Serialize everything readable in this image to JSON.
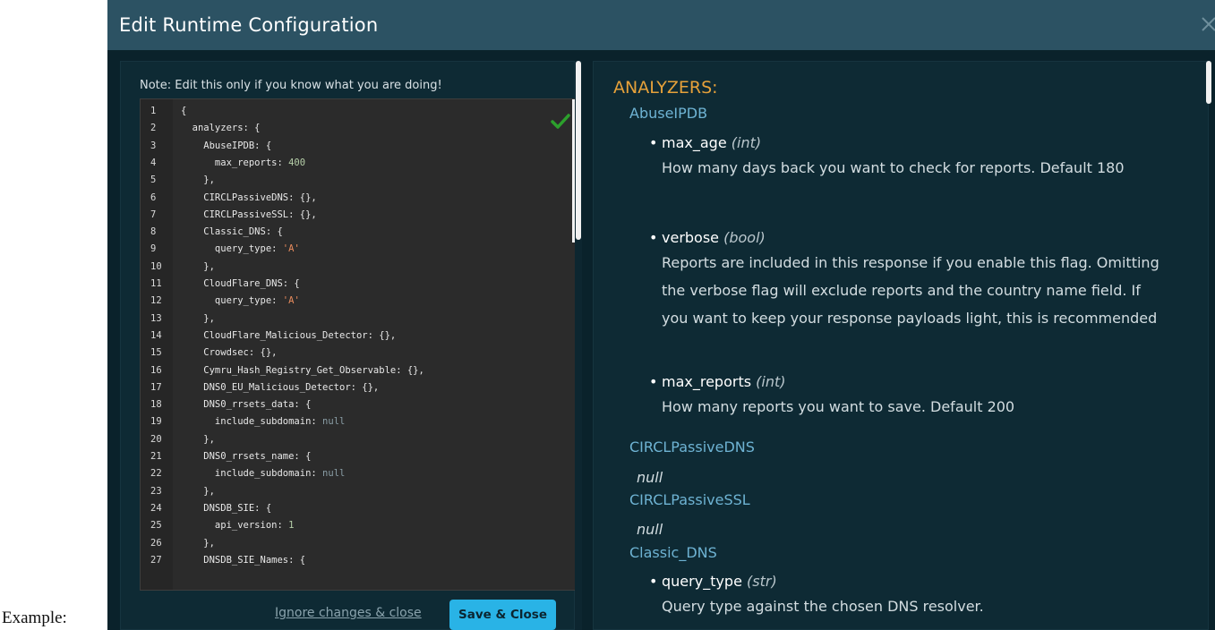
{
  "caption": "Example:",
  "modal": {
    "title": "Edit Runtime Configuration",
    "close_icon": "close-icon"
  },
  "editor": {
    "note": "Note: Edit this only if you know what you are doing!",
    "valid_icon": "check-icon",
    "lines": [
      {
        "n": "1",
        "key": "{",
        "val": "",
        "type": ""
      },
      {
        "n": "2",
        "key": "  analyzers: {",
        "val": "",
        "type": ""
      },
      {
        "n": "3",
        "key": "    AbuseIPDB: {",
        "val": "",
        "type": ""
      },
      {
        "n": "4",
        "key": "      max_reports: ",
        "val": "400",
        "type": "num"
      },
      {
        "n": "5",
        "key": "    },",
        "val": "",
        "type": ""
      },
      {
        "n": "6",
        "key": "    CIRCLPassiveDNS: {},",
        "val": "",
        "type": ""
      },
      {
        "n": "7",
        "key": "    CIRCLPassiveSSL: {},",
        "val": "",
        "type": ""
      },
      {
        "n": "8",
        "key": "    Classic_DNS: {",
        "val": "",
        "type": ""
      },
      {
        "n": "9",
        "key": "      query_type: ",
        "val": "'A'",
        "type": "str"
      },
      {
        "n": "10",
        "key": "    },",
        "val": "",
        "type": ""
      },
      {
        "n": "11",
        "key": "    CloudFlare_DNS: {",
        "val": "",
        "type": ""
      },
      {
        "n": "12",
        "key": "      query_type: ",
        "val": "'A'",
        "type": "str"
      },
      {
        "n": "13",
        "key": "    },",
        "val": "",
        "type": ""
      },
      {
        "n": "14",
        "key": "    CloudFlare_Malicious_Detector: {},",
        "val": "",
        "type": ""
      },
      {
        "n": "15",
        "key": "    Crowdsec: {},",
        "val": "",
        "type": ""
      },
      {
        "n": "16",
        "key": "    Cymru_Hash_Registry_Get_Observable: {},",
        "val": "",
        "type": ""
      },
      {
        "n": "17",
        "key": "    DNS0_EU_Malicious_Detector: {},",
        "val": "",
        "type": ""
      },
      {
        "n": "18",
        "key": "    DNS0_rrsets_data: {",
        "val": "",
        "type": ""
      },
      {
        "n": "19",
        "key": "      include_subdomain: ",
        "val": "null",
        "type": "null"
      },
      {
        "n": "20",
        "key": "    },",
        "val": "",
        "type": ""
      },
      {
        "n": "21",
        "key": "    DNS0_rrsets_name: {",
        "val": "",
        "type": ""
      },
      {
        "n": "22",
        "key": "      include_subdomain: ",
        "val": "null",
        "type": "null"
      },
      {
        "n": "23",
        "key": "    },",
        "val": "",
        "type": ""
      },
      {
        "n": "24",
        "key": "    DNSDB_SIE: {",
        "val": "",
        "type": ""
      },
      {
        "n": "25",
        "key": "      api_version: ",
        "val": "1",
        "type": "num"
      },
      {
        "n": "26",
        "key": "    },",
        "val": "",
        "type": ""
      },
      {
        "n": "27",
        "key": "    DNSDB_SIE_Names: {",
        "val": "",
        "type": ""
      }
    ]
  },
  "actions": {
    "ignore_label": "Ignore changes & close",
    "save_label": "Save & Close"
  },
  "docs": {
    "section_title": "ANALYZERS:",
    "analyzers": [
      {
        "name": "AbuseIPDB",
        "params": [
          {
            "name": "max_age",
            "type": "(int)",
            "desc": "How many days back you want to check for reports. Default 180"
          },
          {
            "name": "verbose",
            "type": "(bool)",
            "desc": "Reports are included in this response if you enable this flag. Omitting the verbose flag will exclude reports and the country name field. If you want to keep your response payloads light, this is recommended"
          },
          {
            "name": "max_reports",
            "type": "(int)",
            "desc": "How many reports you want to save. Default 200"
          }
        ]
      },
      {
        "name": "CIRCLPassiveDNS",
        "null": "null"
      },
      {
        "name": "CIRCLPassiveSSL",
        "null": "null"
      },
      {
        "name": "Classic_DNS",
        "params": [
          {
            "name": "query_type",
            "type": "(str)",
            "desc": "Query type against the chosen DNS resolver."
          }
        ]
      }
    ]
  },
  "colors": {
    "header": "#2c5263",
    "background": "#0a222b",
    "accent": "#29b3e6",
    "section_title": "#e6a13a",
    "analyzer_name": "#6eb3d3"
  }
}
